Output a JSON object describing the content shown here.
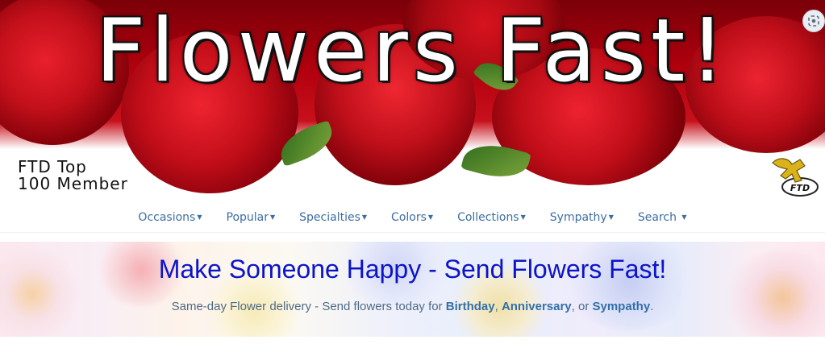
{
  "banner": {
    "title": "Flowers Fast!",
    "badge_line1": "FTD Top",
    "badge_line2": "100 Member",
    "logo_text": "FTD"
  },
  "nav": {
    "items": [
      {
        "label": "Occasions"
      },
      {
        "label": "Popular"
      },
      {
        "label": "Specialties"
      },
      {
        "label": "Colors"
      },
      {
        "label": "Collections"
      },
      {
        "label": "Sympathy"
      },
      {
        "label": "Search"
      }
    ]
  },
  "hero": {
    "title": "Make Someone Happy - Send Flowers Fast!",
    "sub_prefix": "Same-day Flower delivery - Send flowers today for ",
    "link_birthday": "Birthday",
    "sep1": ", ",
    "link_anniversary": "Anniversary",
    "sep2": ", or ",
    "link_sympathy": "Sympathy",
    "sub_end": "."
  },
  "colors": {
    "nav_link": "#3d6ea0",
    "hero_title": "#0b14c9",
    "rose_red": "#c7101b"
  }
}
